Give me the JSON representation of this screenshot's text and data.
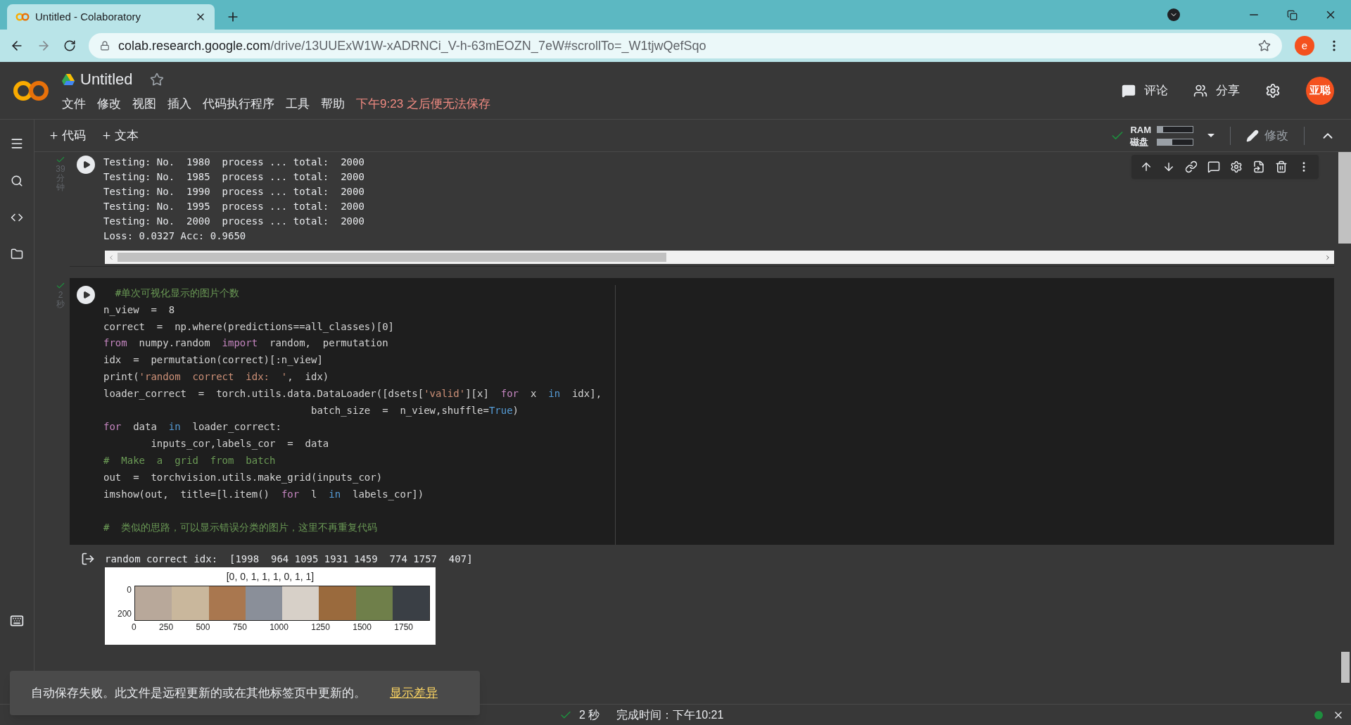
{
  "browser": {
    "tab_title": "Untitled - Colaboratory",
    "url_host": "colab.research.google.com",
    "url_path": "/drive/13UUExW1W-xADRNCi_V-h-63mEOZN_7eW#scrollTo=_W1tjwQefSqo",
    "profile": "e"
  },
  "header": {
    "title": "Untitled",
    "menus": [
      "文件",
      "修改",
      "视图",
      "插入",
      "代码执行程序",
      "工具",
      "帮助"
    ],
    "save_warning": "下午9:23 之后便无法保存",
    "actions": [
      {
        "kind": "comment",
        "label": "评论"
      },
      {
        "kind": "share",
        "label": "分享"
      }
    ],
    "avatar": "亚聪"
  },
  "toolbar": {
    "add": [
      "代码",
      "文本"
    ],
    "connected": true,
    "ram_label": "RAM",
    "ram": {
      "level": 0.15
    },
    "disk_label": "磁盘",
    "disk": {
      "level": 0.42
    },
    "edit": "修改"
  },
  "cells": [
    {
      "done": true,
      "time": "39分钟",
      "output": [
        "Testing: No.  1980  process ... total:  2000",
        "Testing: No.  1985  process ... total:  2000",
        "Testing: No.  1990  process ... total:  2000",
        "Testing: No.  1995  process ... total:  2000",
        "Testing: No.  2000  process ... total:  2000",
        "Loss: 0.0327 Acc: 0.9650"
      ]
    },
    {
      "done": true,
      "time": "2秒",
      "code": [
        [
          {
            "kind": "comment",
            "text": "  #单次可视化显示的图片个数"
          }
        ],
        [
          {
            "kind": "plain",
            "text": "n_view  =  8"
          }
        ],
        [
          {
            "kind": "plain",
            "text": "correct  =  np.where(predictions==all_classes)[0]"
          }
        ],
        [
          {
            "kind": "keyword",
            "text": "from"
          },
          {
            "kind": "plain",
            "text": "  numpy.random  "
          },
          {
            "kind": "keyword",
            "text": "import"
          },
          {
            "kind": "plain",
            "text": "  random,  permutation"
          }
        ],
        [
          {
            "kind": "plain",
            "text": "idx  =  permutation(correct)[:n_view]"
          }
        ],
        [
          {
            "kind": "plain",
            "text": "print("
          },
          {
            "kind": "string",
            "text": "'random  correct  idx:  '"
          },
          {
            "kind": "plain",
            "text": ",  idx)"
          }
        ],
        [
          {
            "kind": "plain",
            "text": "loader_correct  =  torch.utils.data.DataLoader([dsets["
          },
          {
            "kind": "string",
            "text": "'valid'"
          },
          {
            "kind": "plain",
            "text": "][x]  "
          },
          {
            "kind": "keyword",
            "text": "for"
          },
          {
            "kind": "plain",
            "text": "  x  "
          },
          {
            "kind": "operator",
            "text": "in"
          },
          {
            "kind": "plain",
            "text": "  idx],"
          }
        ],
        [
          {
            "kind": "plain",
            "text": "                                   batch_size  =  n_view,shuffle="
          },
          {
            "kind": "operator",
            "text": "True"
          },
          {
            "kind": "plain",
            "text": ")"
          }
        ],
        [
          {
            "kind": "keyword",
            "text": "for"
          },
          {
            "kind": "plain",
            "text": "  data  "
          },
          {
            "kind": "operator",
            "text": "in"
          },
          {
            "kind": "plain",
            "text": "  loader_correct:"
          }
        ],
        [
          {
            "kind": "plain",
            "text": "        inputs_cor,labels_cor  =  data"
          }
        ],
        [
          {
            "kind": "comment",
            "text": "#  Make  a  grid  from  batch"
          }
        ],
        [
          {
            "kind": "plain",
            "text": "out  =  torchvision.utils.make_grid(inputs_cor)"
          }
        ],
        [
          {
            "kind": "plain",
            "text": "imshow(out,  title=[l.item()  "
          },
          {
            "kind": "keyword",
            "text": "for"
          },
          {
            "kind": "plain",
            "text": "  l  "
          },
          {
            "kind": "operator",
            "text": "in"
          },
          {
            "kind": "plain",
            "text": "  labels_cor])"
          }
        ]
      ],
      "code_after_blank": [
        [
          {
            "kind": "comment",
            "text": "#  类似的思路，可以显示错误分类的图片，这里不再重复代码"
          }
        ]
      ],
      "result": "random correct idx:  [1998  964 1095 1931 1459  774 1757  407]",
      "figure": {
        "title": "[0, 0, 1, 1, 1, 0, 1, 1]",
        "yticks": [
          "0",
          "200"
        ],
        "xticks": [
          "0",
          "250",
          "500",
          "750",
          "1000",
          "1250",
          "1500",
          "1750"
        ]
      }
    }
  ],
  "toast": {
    "message": "自动保存失败。此文件是远程更新的或在其他标签页中更新的。",
    "action": "显示差异"
  },
  "status": {
    "duration": "2 秒",
    "finished": "完成时间：下午10:21",
    "connected": true
  }
}
